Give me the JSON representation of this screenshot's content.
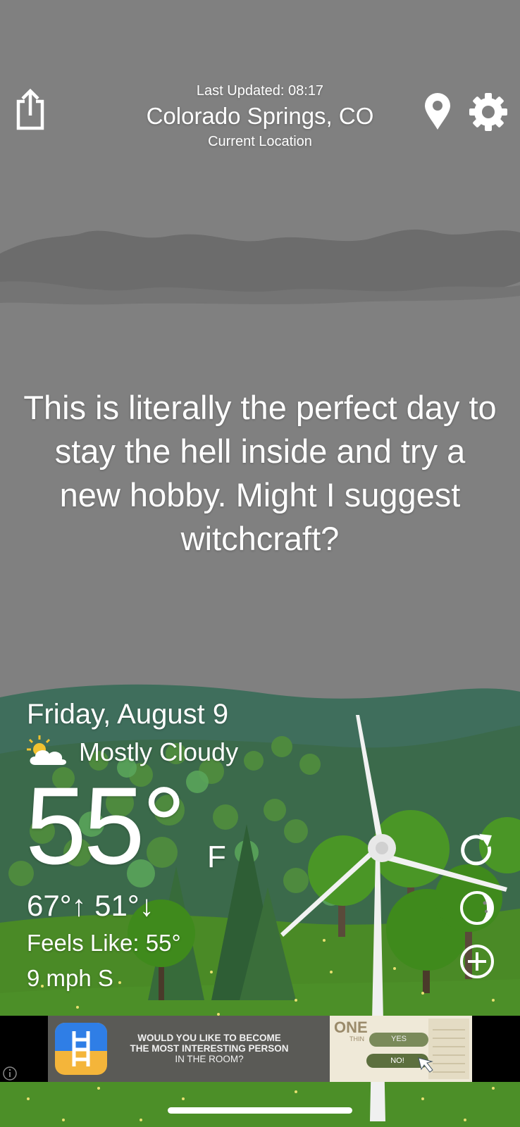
{
  "header": {
    "last_updated": "Last Updated: 08:17",
    "location": "Colorado Springs, CO",
    "location_sub": "Current Location"
  },
  "quote": "This is literally the perfect day to stay the hell inside and try a new hobby. Might I suggest witchcraft?",
  "weather": {
    "date": "Friday, August 9",
    "condition": "Mostly Cloudy",
    "condition_icon": "partly-cloudy-icon",
    "temperature": "55°",
    "unit": "F",
    "high_low": "67°↑ 51°↓",
    "feels_like": "Feels Like: 55°",
    "wind": "9 mph S"
  },
  "icons": {
    "share": "share-icon",
    "location": "location-pin-icon",
    "settings": "gear-icon",
    "refresh": "refresh-icon",
    "moon": "moon-icon",
    "add": "plus-circle-icon",
    "info": "info-icon"
  },
  "ad": {
    "line1": "WOULD YOU LIKE TO BECOME",
    "line2": "THE MOST INTERESTING PERSON",
    "line3": "IN THE ROOM?",
    "image_title": "ONE",
    "image_subtitle": "THIN",
    "yes_label": "YES",
    "no_label": "NO!"
  },
  "colors": {
    "sky": "#808080",
    "cloud": "#6e6e6e",
    "grass": "#4a8a26",
    "hills": "#3e6e57",
    "text": "#ffffff"
  }
}
